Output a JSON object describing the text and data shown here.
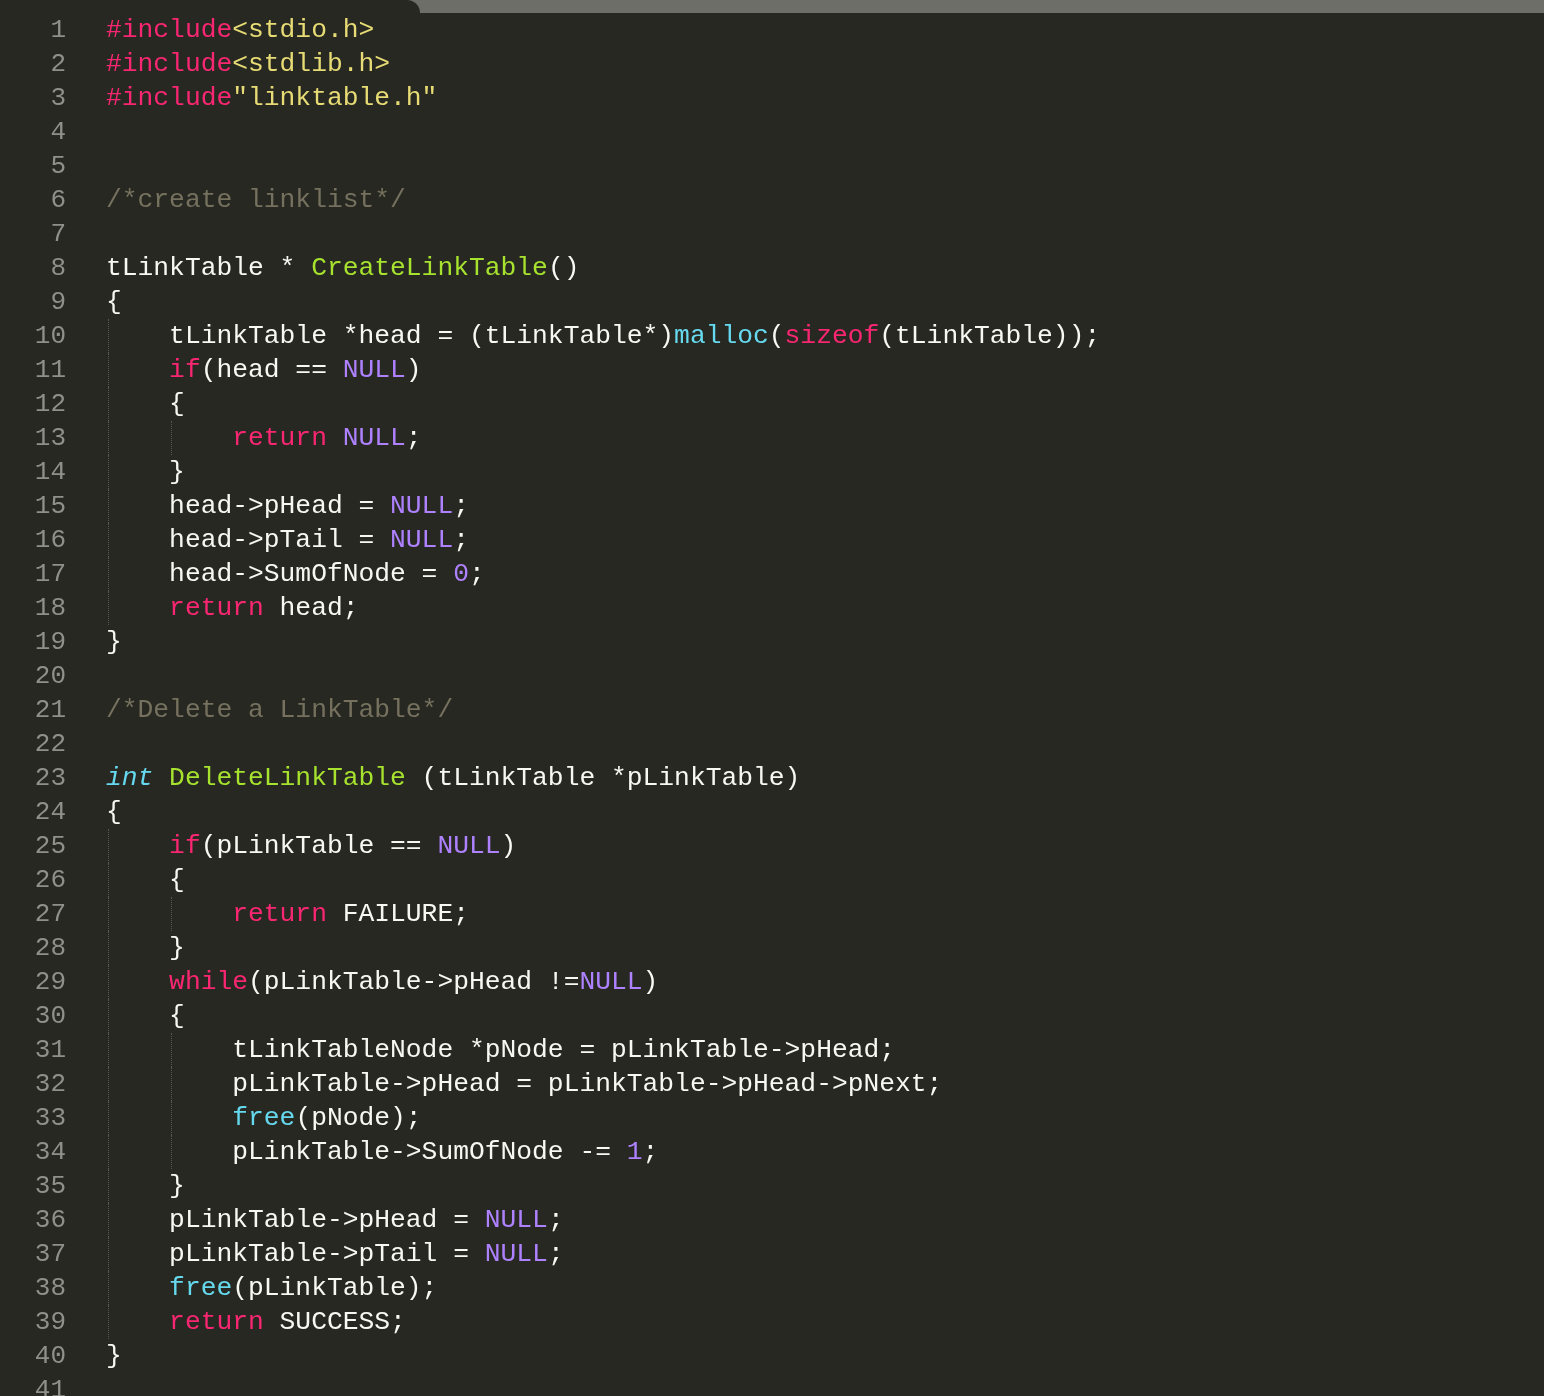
{
  "editor": {
    "lines": [
      {
        "number": "1",
        "tokens": [
          {
            "text": "#include",
            "kind": "keyword"
          },
          {
            "text": "<stdio.h>",
            "kind": "string"
          }
        ]
      },
      {
        "number": "2",
        "tokens": [
          {
            "text": "#include",
            "kind": "keyword"
          },
          {
            "text": "<stdlib.h>",
            "kind": "string"
          }
        ]
      },
      {
        "number": "3",
        "tokens": [
          {
            "text": "#include",
            "kind": "keyword"
          },
          {
            "text": "\"linktable.h\"",
            "kind": "string"
          }
        ]
      },
      {
        "number": "4"
      },
      {
        "number": "5"
      },
      {
        "number": "6",
        "tokens": [
          {
            "text": "/*create linklist*/",
            "kind": "comment"
          }
        ]
      },
      {
        "number": "7"
      },
      {
        "number": "8",
        "tokens": [
          {
            "text": "tLinkTable * ",
            "kind": "plain"
          },
          {
            "text": "CreateLinkTable",
            "kind": "function"
          },
          {
            "text": "()",
            "kind": "plain"
          }
        ]
      },
      {
        "number": "9",
        "tokens": [
          {
            "text": "{",
            "kind": "plain"
          }
        ]
      },
      {
        "number": "10",
        "tokens": [
          {
            "text": "    tLinkTable *head = (tLinkTable*)",
            "kind": "plain"
          },
          {
            "text": "malloc",
            "kind": "builtin"
          },
          {
            "text": "(",
            "kind": "plain"
          },
          {
            "text": "sizeof",
            "kind": "keyword"
          },
          {
            "text": "(tLinkTable));",
            "kind": "plain"
          }
        ]
      },
      {
        "number": "11",
        "tokens": [
          {
            "text": "    if",
            "kind": "keyword"
          },
          {
            "text": "(head == ",
            "kind": "plain"
          },
          {
            "text": "NULL",
            "kind": "constant"
          },
          {
            "text": ")",
            "kind": "plain"
          }
        ]
      },
      {
        "number": "12",
        "tokens": [
          {
            "text": "    {",
            "kind": "plain"
          }
        ]
      },
      {
        "number": "13",
        "tokens": [
          {
            "text": "        return ",
            "kind": "keyword"
          },
          {
            "text": "NULL",
            "kind": "constant"
          },
          {
            "text": ";",
            "kind": "plain"
          }
        ]
      },
      {
        "number": "14",
        "tokens": [
          {
            "text": "    }",
            "kind": "plain"
          }
        ]
      },
      {
        "number": "15",
        "tokens": [
          {
            "text": "    head->pHead = ",
            "kind": "plain"
          },
          {
            "text": "NULL",
            "kind": "constant"
          },
          {
            "text": ";",
            "kind": "plain"
          }
        ]
      },
      {
        "number": "16",
        "tokens": [
          {
            "text": "    head->pTail = ",
            "kind": "plain"
          },
          {
            "text": "NULL",
            "kind": "constant"
          },
          {
            "text": ";",
            "kind": "plain"
          }
        ]
      },
      {
        "number": "17",
        "tokens": [
          {
            "text": "    head->SumOfNode = ",
            "kind": "plain"
          },
          {
            "text": "0",
            "kind": "constant"
          },
          {
            "text": ";",
            "kind": "plain"
          }
        ]
      },
      {
        "number": "18",
        "tokens": [
          {
            "text": "    return",
            "kind": "keyword"
          },
          {
            "text": " head;",
            "kind": "plain"
          }
        ]
      },
      {
        "number": "19",
        "tokens": [
          {
            "text": "}",
            "kind": "plain"
          }
        ]
      },
      {
        "number": "20"
      },
      {
        "number": "21",
        "tokens": [
          {
            "text": "/*Delete a LinkTable*/",
            "kind": "comment"
          }
        ]
      },
      {
        "number": "22"
      },
      {
        "number": "23",
        "tokens": [
          {
            "text": "int",
            "kind": "type"
          },
          {
            "text": " DeleteLinkTable",
            "kind": "function"
          },
          {
            "text": " (tLinkTable *pLinkTable)",
            "kind": "plain"
          }
        ]
      },
      {
        "number": "24",
        "tokens": [
          {
            "text": "{",
            "kind": "plain"
          }
        ]
      },
      {
        "number": "25",
        "tokens": [
          {
            "text": "    if",
            "kind": "keyword"
          },
          {
            "text": "(pLinkTable == ",
            "kind": "plain"
          },
          {
            "text": "NULL",
            "kind": "constant"
          },
          {
            "text": ")",
            "kind": "plain"
          }
        ]
      },
      {
        "number": "26",
        "tokens": [
          {
            "text": "    {",
            "kind": "plain"
          }
        ]
      },
      {
        "number": "27",
        "tokens": [
          {
            "text": "        return",
            "kind": "keyword"
          },
          {
            "text": " FAILURE;",
            "kind": "plain"
          }
        ]
      },
      {
        "number": "28",
        "tokens": [
          {
            "text": "    }",
            "kind": "plain"
          }
        ]
      },
      {
        "number": "29",
        "tokens": [
          {
            "text": "    while",
            "kind": "keyword"
          },
          {
            "text": "(pLinkTable->pHead !=",
            "kind": "plain"
          },
          {
            "text": "NULL",
            "kind": "constant"
          },
          {
            "text": ")",
            "kind": "plain"
          }
        ]
      },
      {
        "number": "30",
        "tokens": [
          {
            "text": "    {",
            "kind": "plain"
          }
        ]
      },
      {
        "number": "31",
        "tokens": [
          {
            "text": "        tLinkTableNode *pNode = pLinkTable->pHead;",
            "kind": "plain"
          }
        ]
      },
      {
        "number": "32",
        "tokens": [
          {
            "text": "        pLinkTable->pHead = pLinkTable->pHead->pNext;",
            "kind": "plain"
          }
        ]
      },
      {
        "number": "33",
        "tokens": [
          {
            "text": "        free",
            "kind": "builtin"
          },
          {
            "text": "(pNode);",
            "kind": "plain"
          }
        ]
      },
      {
        "number": "34",
        "tokens": [
          {
            "text": "        pLinkTable->SumOfNode -= ",
            "kind": "plain"
          },
          {
            "text": "1",
            "kind": "constant"
          },
          {
            "text": ";",
            "kind": "plain"
          }
        ]
      },
      {
        "number": "35",
        "tokens": [
          {
            "text": "    }",
            "kind": "plain"
          }
        ]
      },
      {
        "number": "36",
        "tokens": [
          {
            "text": "    pLinkTable->pHead = ",
            "kind": "plain"
          },
          {
            "text": "NULL",
            "kind": "constant"
          },
          {
            "text": ";",
            "kind": "plain"
          }
        ]
      },
      {
        "number": "37",
        "tokens": [
          {
            "text": "    pLinkTable->pTail = ",
            "kind": "plain"
          },
          {
            "text": "NULL",
            "kind": "constant"
          },
          {
            "text": ";",
            "kind": "plain"
          }
        ]
      },
      {
        "number": "38",
        "tokens": [
          {
            "text": "    free",
            "kind": "builtin"
          },
          {
            "text": "(pLinkTable);",
            "kind": "plain"
          }
        ]
      },
      {
        "number": "39",
        "tokens": [
          {
            "text": "    return",
            "kind": "keyword"
          },
          {
            "text": " SUCCESS;",
            "kind": "plain"
          }
        ]
      },
      {
        "number": "40",
        "tokens": [
          {
            "text": "}",
            "kind": "plain"
          }
        ]
      },
      {
        "number": "41"
      }
    ]
  }
}
